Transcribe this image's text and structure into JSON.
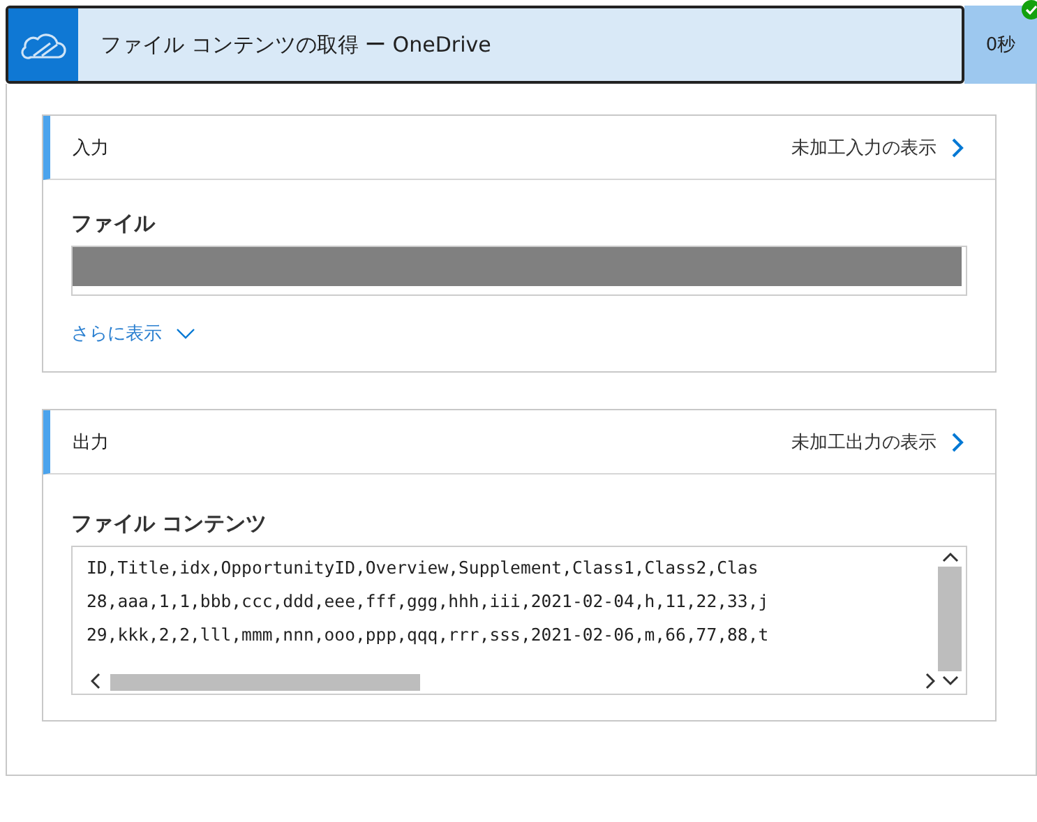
{
  "header": {
    "title": "ファイル コンテンツの取得 ー OneDrive",
    "duration": "0秒",
    "succeeded": true
  },
  "input": {
    "title": "入力",
    "raw_link": "未加工入力の表示",
    "fields": [
      {
        "label": "ファイル",
        "redacted": true
      }
    ],
    "more": "さらに表示"
  },
  "output": {
    "title": "出力",
    "raw_link": "未加工出力の表示",
    "field_label": "ファイル コンテンツ",
    "lines": [
      "ID,Title,idx,OpportunityID,Overview,Supplement,Class1,Class2,Clas",
      "28,aaa,1,1,bbb,ccc,ddd,eee,fff,ggg,hhh,iii,2021-02-04,h,11,22,33,j",
      "29,kkk,2,2,lll,mmm,nnn,ooo,ppp,qqq,rrr,sss,2021-02-06,m,66,77,88,t"
    ]
  }
}
